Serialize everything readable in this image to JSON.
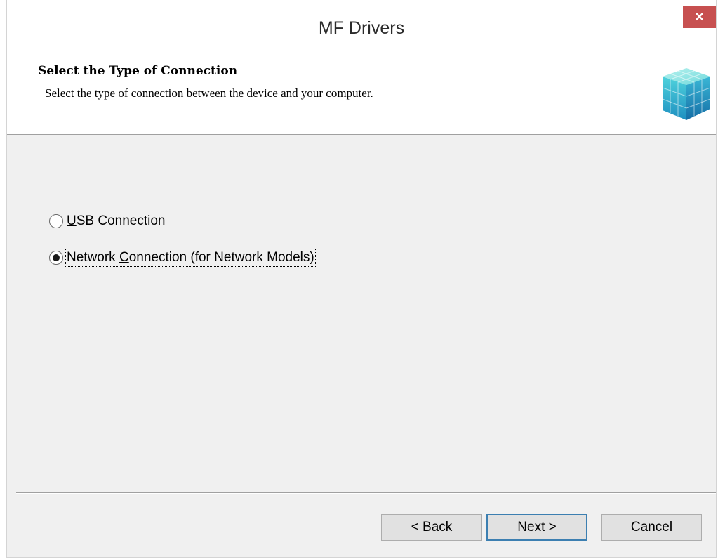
{
  "window": {
    "title": "MF Drivers",
    "close_glyph": "×",
    "close_icon": "close-icon"
  },
  "header": {
    "title": "Select the Type of Connection",
    "subtitle": "Select the type of connection between the device and your computer.",
    "icon": "cube-icon"
  },
  "options": [
    {
      "label": "USB Connection",
      "mnemonic": "U",
      "rest": "SB Connection",
      "checked": false
    },
    {
      "label": "Network Connection (for Network Models)",
      "pre": "Network ",
      "mnemonic": "C",
      "rest": "onnection (for Network Models)",
      "checked": true
    }
  ],
  "buttons": {
    "back": {
      "label": "< Back",
      "pre": "< ",
      "mnemonic": "B",
      "rest": "ack"
    },
    "next": {
      "label": "Next >",
      "mnemonic": "N",
      "rest": "ext >"
    },
    "cancel": {
      "label": "Cancel"
    }
  },
  "colors": {
    "close_button": "#c75050",
    "default_button_border": "#3c7fb1",
    "window_bg": "#f0f0f0"
  }
}
